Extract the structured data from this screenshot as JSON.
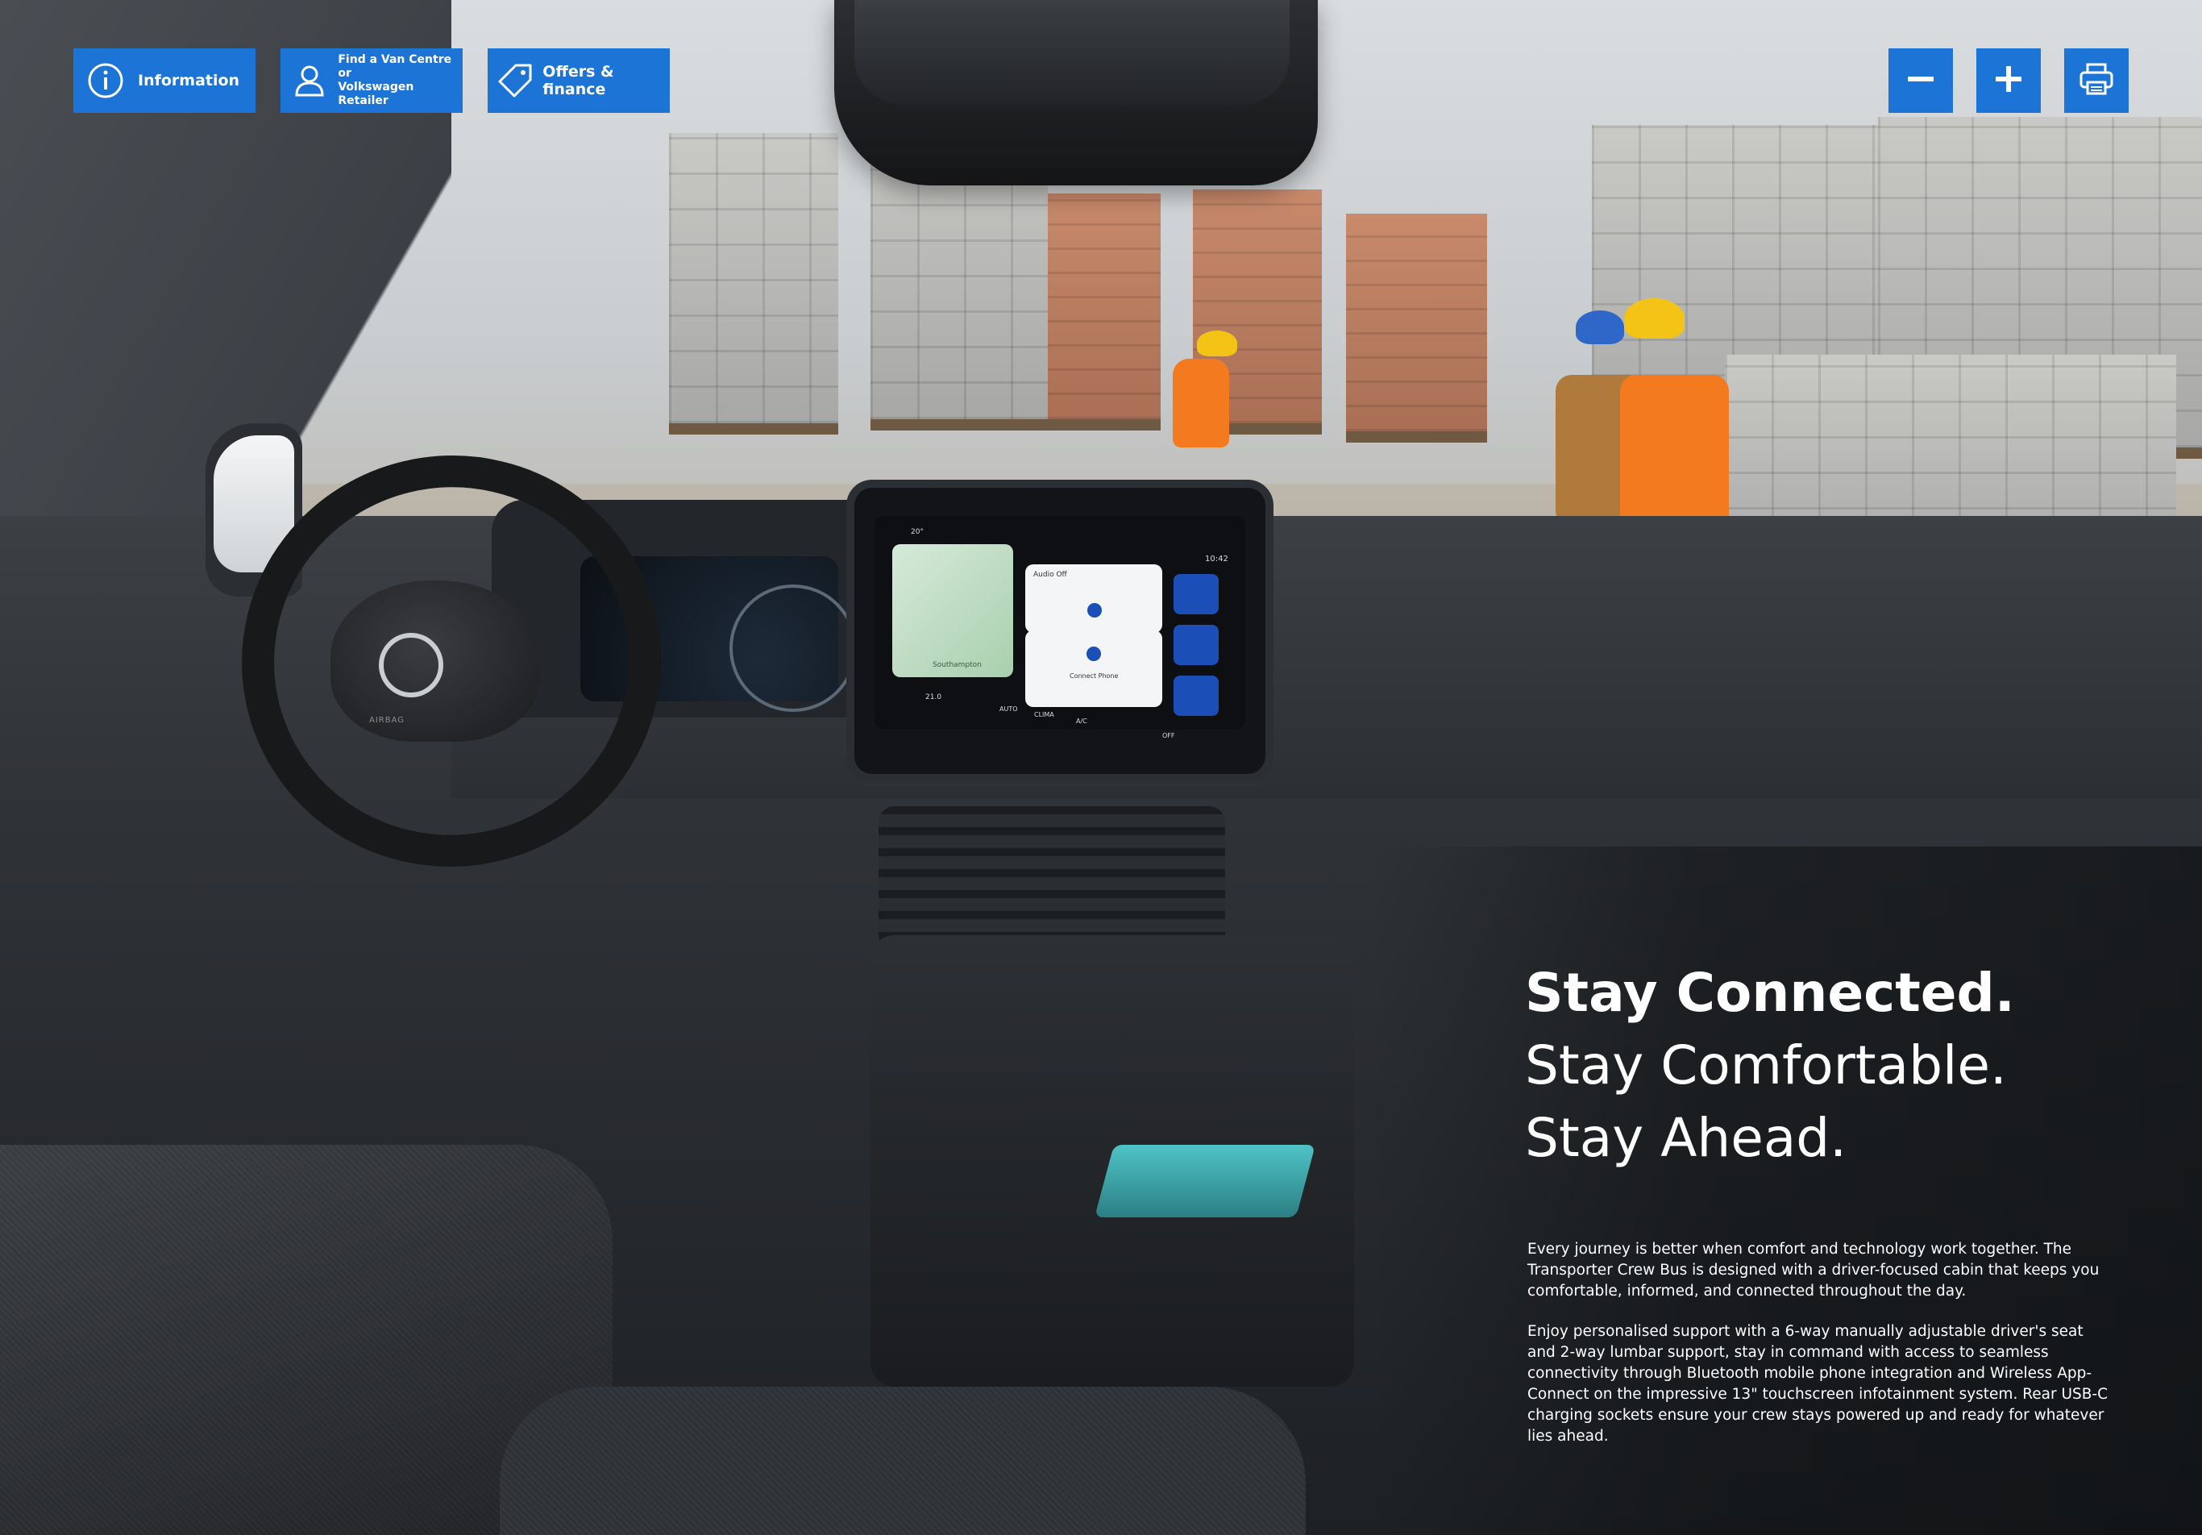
{
  "toolbar": {
    "information_label": "Information",
    "find_label_line1": "Find a Van Centre or",
    "find_label_line2": "Volkswagen Retailer",
    "offers_label": "Offers & finance"
  },
  "controls": {
    "zoom_out_icon": "minus-icon",
    "zoom_in_icon": "plus-icon",
    "print_icon": "printer-icon"
  },
  "dashboard": {
    "clock": "10:42",
    "temp": "20°",
    "tile_audio": "Audio Off",
    "tile_phone": "Connect Phone",
    "map_label": "Southampton",
    "climate_temp": "21.0",
    "climate_auto": "AUTO",
    "climate_label": "CLIMA",
    "climate_ac": "A/C",
    "climate_off": "OFF",
    "airbag": "AIRBAG"
  },
  "headline": {
    "line1": "Stay Connected.",
    "line2": "Stay Comfortable.",
    "line3": "Stay Ahead."
  },
  "body": {
    "para1": "Every journey is better when comfort and technology work together. The Transporter Crew Bus is designed with a driver-focused cabin that keeps you comfortable, informed, and connected throughout the day.",
    "para2": " Enjoy personalised support with a 6-way manually adjustable driver's seat and 2-way lumbar support, stay in command with access to seamless connectivity through Bluetooth mobile phone integration and Wireless App-Connect on the impressive 13\" touchscreen infotainment system. Rear USB-C charging sockets ensure your crew stays powered up and ready for whatever lies ahead."
  },
  "colors": {
    "button_blue": "#1c75d6",
    "text_white": "#ffffff"
  }
}
